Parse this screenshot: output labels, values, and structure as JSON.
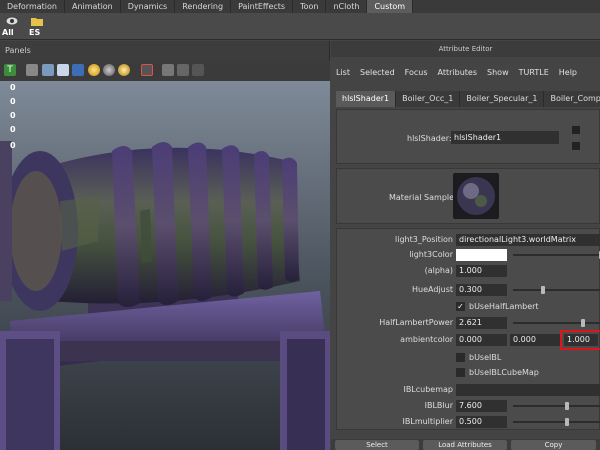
{
  "shelf_tabs": [
    "Deformation",
    "Animation",
    "Dynamics",
    "Rendering",
    "PaintEffects",
    "Toon",
    "nCloth",
    "Custom"
  ],
  "shelf_active": "Custom",
  "shelf_buttons": [
    {
      "label": "All",
      "icon": "eye-icon"
    },
    {
      "label": "ES",
      "icon": "folder-icon"
    }
  ],
  "panels": {
    "title": "Panels",
    "viewport_numbers": [
      "0",
      "0",
      "0",
      "0",
      "0"
    ]
  },
  "attribute_editor": {
    "title": "Attribute Editor",
    "menu": [
      "List",
      "Selected",
      "Focus",
      "Attributes",
      "Show",
      "TURTLE",
      "Help"
    ],
    "tabs": [
      "hlslShader1",
      "Boiler_Occ_1",
      "Boiler_Specular_1",
      "Boiler_Complet"
    ],
    "shader_label": "hlslShader:",
    "shader_value": "hlslShader1",
    "material_sample_label": "Material Sample",
    "attributes": {
      "light3_position": {
        "label": "light3_Position",
        "value": "directionalLight3.worldMatrix"
      },
      "light3_color": {
        "label": "light3Color",
        "color": "#ffffff"
      },
      "alpha": {
        "label": "(alpha)",
        "value": "1.000"
      },
      "hue_adjust": {
        "label": "HueAdjust",
        "value": "0.300"
      },
      "use_half_lambert": {
        "label": "bUseHalfLambert",
        "checked": true
      },
      "half_lambert_power": {
        "label": "HalfLambertPower",
        "value": "2.621"
      },
      "ambient_color": {
        "label": "ambientcolor",
        "values": [
          "0.000",
          "0.000",
          "1.000"
        ]
      },
      "use_ibl": {
        "label": "bUseIBL",
        "checked": false
      },
      "use_ibl_cubemap": {
        "label": "bUseIBLCubeMap",
        "checked": false
      },
      "ibl_cubemap": {
        "label": "IBLcubemap",
        "value": ""
      },
      "ibl_blur": {
        "label": "IBLBlur",
        "value": "7.600"
      },
      "ibl_multiplier": {
        "label": "IBLmultiplier",
        "value": "0.500"
      }
    },
    "bottom_buttons": [
      "Select",
      "Load Attributes",
      "Copy"
    ]
  },
  "colors": {
    "highlight": "#e0141b",
    "boiler_purple": "#4a3d6a",
    "boiler_green": "#4d5a46"
  }
}
